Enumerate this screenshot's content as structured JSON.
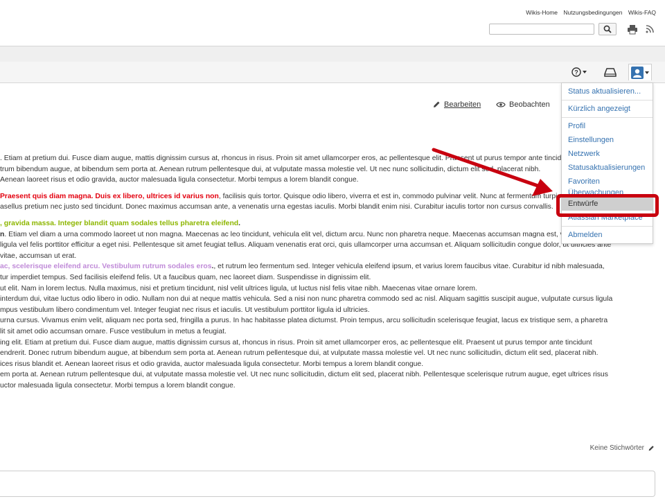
{
  "header": {
    "links": [
      "Wikis-Home",
      "Nutzungsbedingungen",
      "Wikis-FAQ"
    ],
    "search": {
      "value": "",
      "placeholder": ""
    }
  },
  "page_actions": {
    "edit": "Bearbeiten",
    "watch": "Beobachten"
  },
  "user_menu": {
    "items": [
      "Status aktualisieren...",
      "Kürzlich angezeigt",
      "Profil",
      "Einstellungen",
      "Netzwerk",
      "Statusaktualisierungen",
      "Favoriten",
      "Überwachungen",
      "Entwürfe",
      "Atlassian Marketplace",
      "Abmelden"
    ],
    "highlighted": "Entwürfe"
  },
  "content": {
    "p1": [
      ". Etiam at pretium dui. Fusce diam augue, mattis dignissim cursus at, rhoncus in risus. Proin sit amet ullamcorper eros, ac pellentesque elit. Praesent ut purus tempor ante tincidunt",
      "trum bibendum augue, at bibendum sem porta at. Aenean rutrum pellentesque dui, at vulputate massa molestie vel. Ut nec nunc sollicitudin, dictum elit sed, placerat nibh.",
      "Aenean laoreet risus et odio gravida, auctor malesuada ligula consectetur. Morbi tempus a lorem blandit congue."
    ],
    "p2_red": "Praesent quis diam magna. Duis ex libero, ultrices id varius non",
    "p2_rest": ", facilisis quis tortor. Quisque odio libero, viverra et est in, commodo pulvinar velit. Nunc at fermentum turpis.",
    "p2_line2": "asellus pretium nec justo sed tincidunt. Donec maximus accumsan ante, a venenatis urna egestas iaculis. Morbi blandit enim nisi. Curabitur iaculis tortor non cursus convallis.",
    "p3_green": ", gravida massa. Integer blandit quam sodales tellus pharetra eleifend",
    "p3_dot": ".",
    "p3_bold": "n",
    "p3_line2": ". Etiam vel diam a urna commodo laoreet ut non magna. Maecenas ac leo tincidunt, vehicula elit vel, dictum arcu. Nunc non pharetra neque. Maecenas accumsan magna est, vitae",
    "p3_line3": " ligula vel felis porttitor efficitur a eget nisi. Pellentesque sit amet feugiat tellus. Aliquam venenatis erat orci, quis ullamcorper urna accumsan et. Aliquam sollicitudin congue dolor, ut ultricies ante",
    "p3_line4": "vitae, accumsan ut erat.",
    "p3_purple": "ac, scelerisque eleifend arcu. Vestibulum rutrum sodales eros",
    "p3_purple_rest": ", et rutrum leo fermentum sed. Integer vehicula eleifend ipsum, et varius lorem faucibus vitae. Curabitur id nibh malesuada,",
    "p3_rest": [
      "tur imperdiet tempus. Sed facilisis eleifend felis. Ut a faucibus quam, nec laoreet diam. Suspendisse in dignissim elit.",
      "ut elit. Nam in lorem lectus. Nulla maximus, nisi et pretium tincidunt, nisl velit ultrices ligula, ut luctus nisl felis vitae nibh. Maecenas vitae ornare lorem.",
      " interdum dui, vitae luctus odio libero in odio. Nullam non dui at neque mattis vehicula. Sed a nisi non nunc pharetra commodo sed ac nisl. Aliquam sagittis suscipit augue, vulputate cursus ligula",
      "mpus vestibulum libero condimentum vel. Integer feugiat nec risus et iaculis. Ut vestibulum porttitor ligula id ultricies.",
      " urna cursus. Vivamus enim velit, aliquam nec porta sed, fringilla a purus. In hac habitasse platea dictumst. Proin tempus, arcu sollicitudin scelerisque feugiat, lacus ex tristique sem, a pharetra",
      "lit sit amet odio accumsan ornare. Fusce vestibulum in metus a feugiat.",
      "ing elit. Etiam at pretium dui. Fusce diam augue, mattis dignissim cursus at, rhoncus in risus. Proin sit amet ullamcorper eros, ac pellentesque elit. Praesent ut purus tempor ante tincidunt",
      "endrerit. Donec rutrum bibendum augue, at bibendum sem porta at. Aenean rutrum pellentesque dui, at vulputate massa molestie vel. Ut nec nunc sollicitudin, dictum elit sed, placerat nibh.",
      "ices risus blandit et. Aenean laoreet risus et odio gravida, auctor malesuada ligula consectetur. Morbi tempus a lorem blandit congue.",
      "em porta at. Aenean rutrum pellentesque dui, at vulputate massa molestie vel. Ut nec nunc sollicitudin, dictum elit sed, placerat nibh. Pellentesque scelerisque rutrum augue, eget ultrices risus",
      "uctor malesuada ligula consectetur. Morbi tempus a lorem blandit congue."
    ]
  },
  "footer": {
    "labels": "Keine Stichwörter"
  },
  "annotation_colors": {
    "arrow": "#c8000f",
    "box": "#c8000f"
  }
}
